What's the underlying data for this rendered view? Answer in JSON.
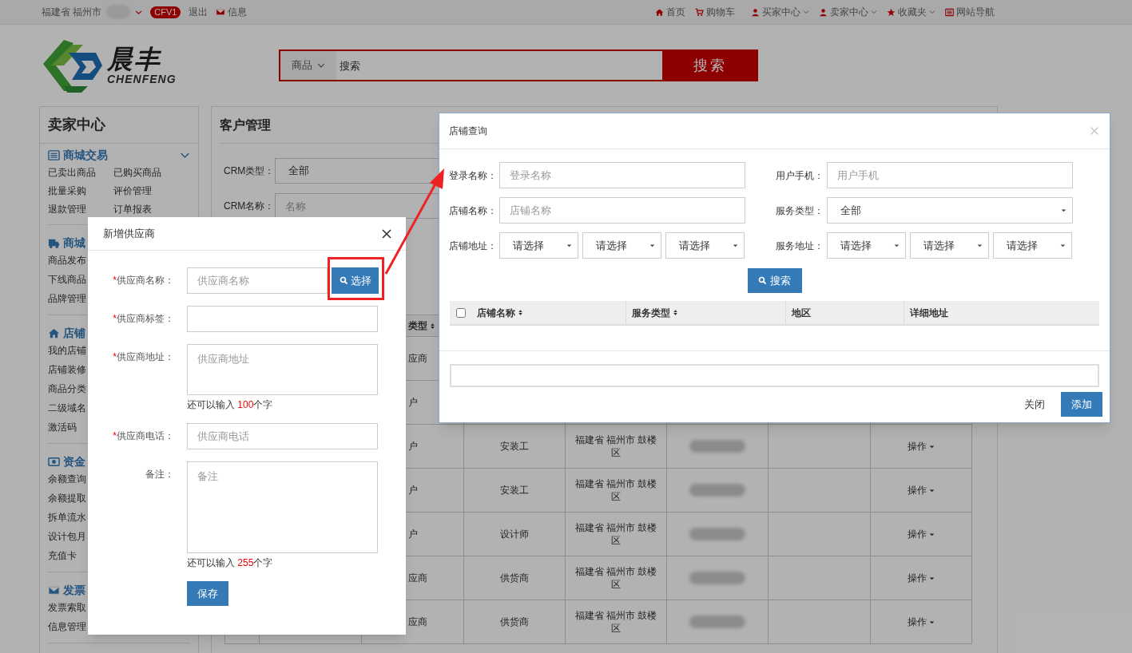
{
  "top_bar": {
    "location": "福建省 福州市",
    "badge": "CFV1",
    "links": [
      {
        "label": "退出"
      },
      {
        "label": "信息"
      }
    ],
    "nav": [
      {
        "label": "首页",
        "dropdown": false
      },
      {
        "label": "购物车",
        "dropdown": false
      },
      {
        "label": "买家中心",
        "dropdown": true
      },
      {
        "label": "卖家中心",
        "dropdown": true
      },
      {
        "label": "收藏夹",
        "dropdown": true
      },
      {
        "label": "网站导航",
        "dropdown": false
      }
    ]
  },
  "header": {
    "logo_text": "晨丰",
    "logo_subtext": "CHENFENG",
    "search": {
      "category": "商品",
      "placeholder": "搜索",
      "button": "搜索"
    }
  },
  "sidebar": {
    "title": "卖家中心",
    "sections": [
      {
        "title": "商城交易",
        "expanded": true,
        "rows": [
          [
            "已卖出商品",
            "已购买商品"
          ],
          [
            "批量采购",
            "评价管理"
          ],
          [
            "退款管理",
            "订单报表"
          ]
        ]
      },
      {
        "title": "商城",
        "rows": [
          [
            "商品发布"
          ],
          [
            "下线商品"
          ],
          [
            "品牌管理"
          ]
        ]
      },
      {
        "title": "店铺",
        "rows": [
          [
            "我的店铺"
          ],
          [
            "店铺装修"
          ],
          [
            "商品分类"
          ],
          [
            "二级域名"
          ],
          [
            "激活码"
          ]
        ]
      },
      {
        "title": "资金",
        "rows": [
          [
            "余额查询"
          ],
          [
            "余额提取"
          ],
          [
            "拆单流水"
          ],
          [
            "设计包月"
          ],
          [
            "充值卡"
          ]
        ]
      },
      {
        "title": "发票",
        "rows": [
          [
            "发票索取"
          ],
          [
            "信息管理"
          ]
        ]
      }
    ]
  },
  "main": {
    "title": "客户管理",
    "filters": [
      {
        "label": "CRM类型：",
        "kind": "select",
        "value": "全部"
      },
      {
        "label": "CRM名称：",
        "kind": "input",
        "placeholder": "名称"
      }
    ],
    "table": {
      "header_fragment": "类型",
      "rows": [
        {
          "column_1": "应商"
        },
        {
          "column_1": "户"
        },
        {
          "column_1": "户",
          "service_type": "安装工",
          "region": "福建省 福州市 鼓楼区",
          "action": "操作"
        },
        {
          "column_1": "户",
          "service_type": "安装工",
          "region": "福建省 福州市 鼓楼区",
          "action": "操作"
        },
        {
          "column_1": "户",
          "service_type": "设计师",
          "region": "福建省 福州市 鼓楼区",
          "action": "操作"
        },
        {
          "column_1": "应商",
          "service_type": "供货商",
          "region": "福建省 福州市 鼓楼区",
          "action": "操作"
        },
        {
          "column_1": "应商",
          "service_type": "供货商",
          "region": "福建省 福州市 鼓楼区",
          "action": "操作"
        }
      ]
    }
  },
  "supplier_dialog": {
    "title": "新增供应商",
    "required_mark": "*",
    "fields": [
      {
        "label": "供应商名称：",
        "required": true,
        "kind": "input_with_button",
        "placeholder": "供应商名称",
        "button": "选择"
      },
      {
        "label": "供应商标签：",
        "required": true,
        "kind": "input"
      },
      {
        "label": "供应商地址：",
        "required": true,
        "kind": "textarea",
        "placeholder": "供应商地址",
        "hint_prefix": "还可以输入 ",
        "hint_count": "100",
        "hint_suffix": "个字"
      },
      {
        "label": "供应商电话：",
        "required": true,
        "kind": "input",
        "placeholder": "供应商电话"
      },
      {
        "label": "备注：",
        "required": false,
        "kind": "textarea",
        "placeholder": "备注",
        "hint_prefix": "还可以输入 ",
        "hint_count": "255",
        "hint_suffix": "个字"
      }
    ],
    "save_button": "保存"
  },
  "store_dialog": {
    "title": "店铺查询",
    "fields": [
      {
        "label": "登录名称：",
        "kind": "input",
        "placeholder": "登录名称"
      },
      {
        "label": "用户手机：",
        "kind": "input",
        "placeholder": "用户手机"
      },
      {
        "label": "店铺名称：",
        "kind": "input",
        "placeholder": "店铺名称"
      },
      {
        "label": "服务类型：",
        "kind": "select",
        "value": "全部"
      },
      {
        "label": "店铺地址：",
        "kind": "select3",
        "values": [
          "请选择",
          "请选择",
          "请选择"
        ]
      },
      {
        "label": "服务地址：",
        "kind": "select3",
        "values": [
          "请选择",
          "请选择",
          "请选择"
        ]
      }
    ],
    "search_button": "搜索",
    "table": {
      "select_all_checked": false,
      "columns": [
        {
          "label": "店铺名称",
          "sortable": true
        },
        {
          "label": "服务类型",
          "sortable": true
        },
        {
          "label": "地区",
          "sortable": false
        },
        {
          "label": "详细地址",
          "sortable": false
        }
      ]
    },
    "close_button": "关闭",
    "add_button": "添加"
  }
}
